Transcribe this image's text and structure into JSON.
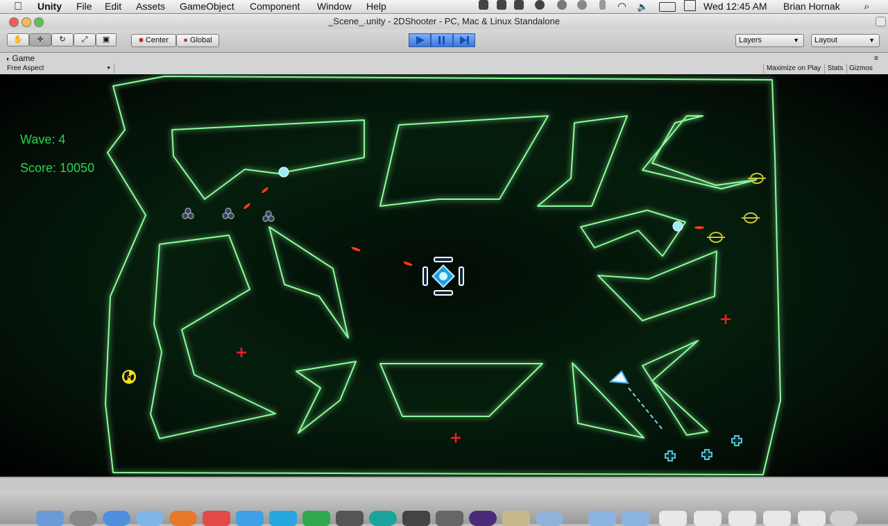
{
  "menubar": {
    "app": "Unity",
    "items": [
      "File",
      "Edit",
      "Assets",
      "GameObject",
      "Component",
      "Window",
      "Help"
    ],
    "clock": "Wed 12:45 AM",
    "user": "Brian Hornak"
  },
  "window": {
    "title": "_Scene_.unity - 2DShooter - PC, Mac & Linux Standalone"
  },
  "toolbar": {
    "pivot": "Center",
    "space": "Global",
    "layers": "Layers",
    "layout": "Layout"
  },
  "game_panel": {
    "tab": "Game",
    "aspect": "Free Aspect",
    "maximize": "Maximize on Play",
    "stats": "Stats",
    "gizmos": "Gizmos"
  },
  "hud": {
    "wave": "Wave: 4",
    "score": "Score: 10050"
  },
  "colors": {
    "wall": "#8dff9d",
    "hud_text": "#27d34f",
    "enemy_seeker": "#9ee9f2",
    "bullet": "#ff3a1a",
    "pickup_red": "#ff1a1a",
    "ring": "#c9c23a",
    "cross_cyan": "#4cc7d1",
    "play_blue": "#3b77d6"
  }
}
